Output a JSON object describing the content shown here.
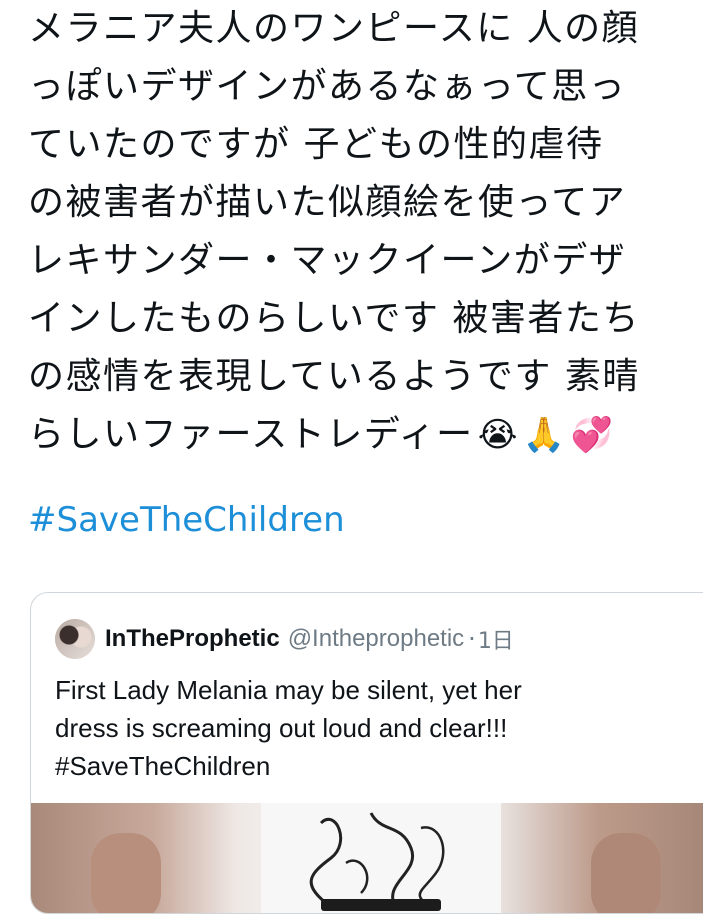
{
  "tweet": {
    "lines": [
      "メラニア夫人のワンピースに 人の顔",
      "っぽいデザインがあるなぁって思っ",
      "ていたのですが  子どもの性的虐待",
      "の被害者が描いた似顔絵を使ってア",
      "レキサンダー・マックイーンがデザ",
      "インしたものらしいです  被害者たち",
      "の感情を表現しているようです 素晴",
      "らしいファーストレディー"
    ],
    "emojis": [
      "😭",
      "🙏",
      "💞"
    ],
    "hashtag": "#SaveTheChildren"
  },
  "quote": {
    "name": "InTheProphetic",
    "handle": "@Intheprophetic",
    "separator": "·",
    "time": "1日",
    "text_lines": [
      "First Lady Melania may be silent,  yet her",
      "dress is screaming out loud and clear!!!",
      "#SaveTheChildren"
    ]
  },
  "colors": {
    "hashtag": "#1d8fd8",
    "secondary_text": "#6e7b85",
    "card_border": "#d0d6db"
  }
}
